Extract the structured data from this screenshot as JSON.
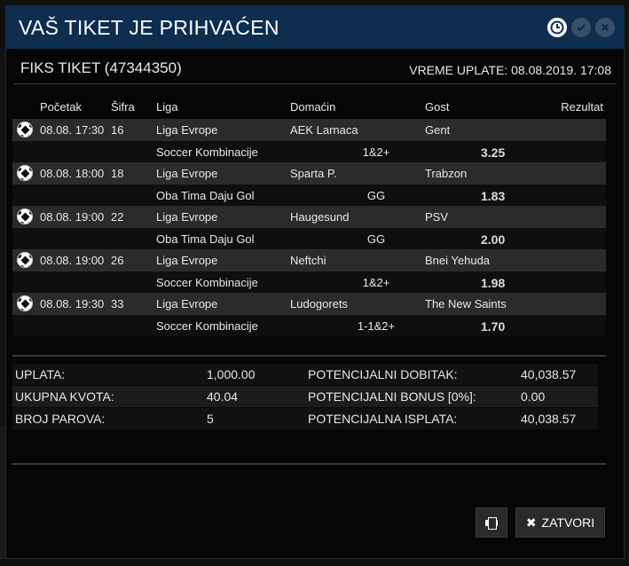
{
  "modal": {
    "title": "VAŠ TIKET JE PRIHVAĆEN",
    "header_icons": [
      "clock-icon",
      "check-circle-icon",
      "close-circle-icon"
    ]
  },
  "ticket": {
    "title": "FIKS TIKET (47344350)",
    "payment_time": "VREME UPLATE: 08.08.2019. 17:08"
  },
  "table": {
    "headers": {
      "start": "Početak",
      "code": "Šifra",
      "league": "Liga",
      "home": "Domaćin",
      "away": "Gost",
      "result": "Rezultat"
    },
    "rows": [
      {
        "start": "08.08. 17:30",
        "code": "16",
        "league": "Liga Evrope",
        "home": "AEK Larnaca",
        "away": "Gent",
        "market": "Soccer Kombinacije",
        "tip": "1&2+",
        "odd": "3.25"
      },
      {
        "start": "08.08. 18:00",
        "code": "18",
        "league": "Liga Evrope",
        "home": "Sparta P.",
        "away": "Trabzon",
        "market": "Oba Tima Daju Gol",
        "tip": "GG",
        "odd": "1.83"
      },
      {
        "start": "08.08. 19:00",
        "code": "22",
        "league": "Liga Evrope",
        "home": "Haugesund",
        "away": "PSV",
        "market": "Oba Tima Daju Gol",
        "tip": "GG",
        "odd": "2.00"
      },
      {
        "start": "08.08. 19:00",
        "code": "26",
        "league": "Liga Evrope",
        "home": "Neftchi",
        "away": "Bnei Yehuda",
        "market": "Soccer Kombinacije",
        "tip": "1&2+",
        "odd": "1.98"
      },
      {
        "start": "08.08. 19:30",
        "code": "33",
        "league": "Liga Evrope",
        "home": "Ludogorets",
        "away": "The New Saints",
        "market": "Soccer Kombinacije",
        "tip": "1-1&2+",
        "odd": "1.70"
      }
    ]
  },
  "summary": {
    "payment_label": "UPLATA:",
    "payment_value": "1,000.00",
    "total_odds_label": "UKUPNA KVOTA:",
    "total_odds_value": "40.04",
    "pairs_label": "BROJ PAROVA:",
    "pairs_value": "5",
    "potential_win_label": "POTENCIJALNI DOBITAK:",
    "potential_win_value": "40,038.57",
    "potential_bonus_label": "POTENCIJALNI BONUS [0%]:",
    "potential_bonus_value": "0.00",
    "potential_payout_label": "POTENCIJALNA ISPLATA:",
    "potential_payout_value": "40,038.57"
  },
  "buttons": {
    "print_icon": "printer-icon",
    "close_label": "ZATVORI",
    "close_icon": "x-icon"
  },
  "colors": {
    "header_bg": "#0e2d4f",
    "match_row_bg": "#2b2b2b",
    "modal_bg": "#060606"
  }
}
